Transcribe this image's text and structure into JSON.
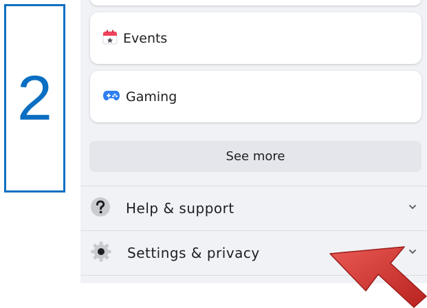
{
  "step": {
    "number": "2",
    "color": "#0a6fc2"
  },
  "menu": {
    "shortcuts": [
      {
        "label": "Events",
        "icon": "calendar-icon"
      },
      {
        "label": "Gaming",
        "icon": "gamepad-icon"
      }
    ],
    "see_more_label": "See more",
    "sections": [
      {
        "label": "Help & support",
        "icon": "question-icon"
      },
      {
        "label": "Settings & privacy",
        "icon": "gear-icon"
      }
    ]
  },
  "annotation": {
    "icon": "pointer-arrow-icon",
    "color": "#d83a35"
  }
}
